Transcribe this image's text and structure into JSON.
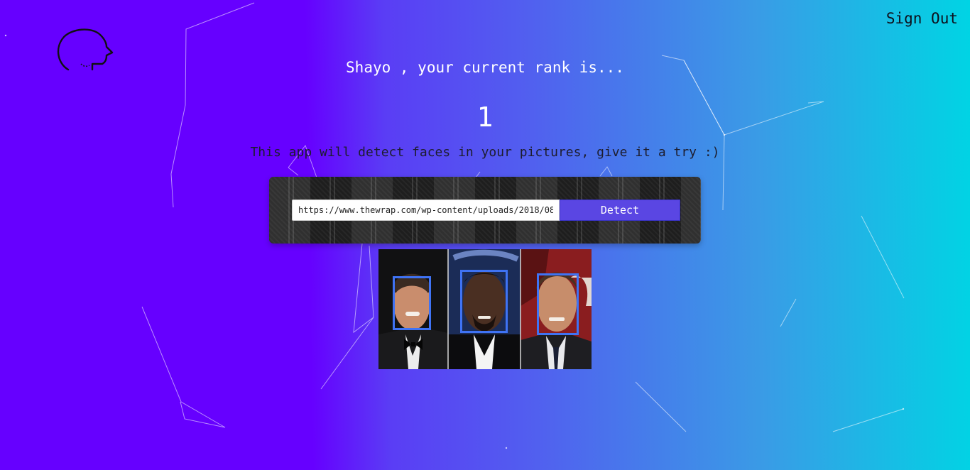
{
  "header": {
    "logo_icon": "brain-head-outline-icon",
    "sign_out_label": "Sign Out"
  },
  "rank": {
    "user_name": "Shayo",
    "line": "Shayo , your current rank is...",
    "value": "1"
  },
  "tagline": "This app will detect faces in your pictures, give it a try :)",
  "image_form": {
    "url_value": "https://www.thewrap.com/wp-content/uploads/2018/08/...",
    "detect_label": "Detect"
  },
  "result_image": {
    "description_icon": "face-photo-icon",
    "detected_faces_count": 3
  },
  "colors": {
    "gradient_start": "#6600ff",
    "gradient_end": "#00d4e4",
    "button": "#5a46e3",
    "face_box": "#3f73f4"
  }
}
